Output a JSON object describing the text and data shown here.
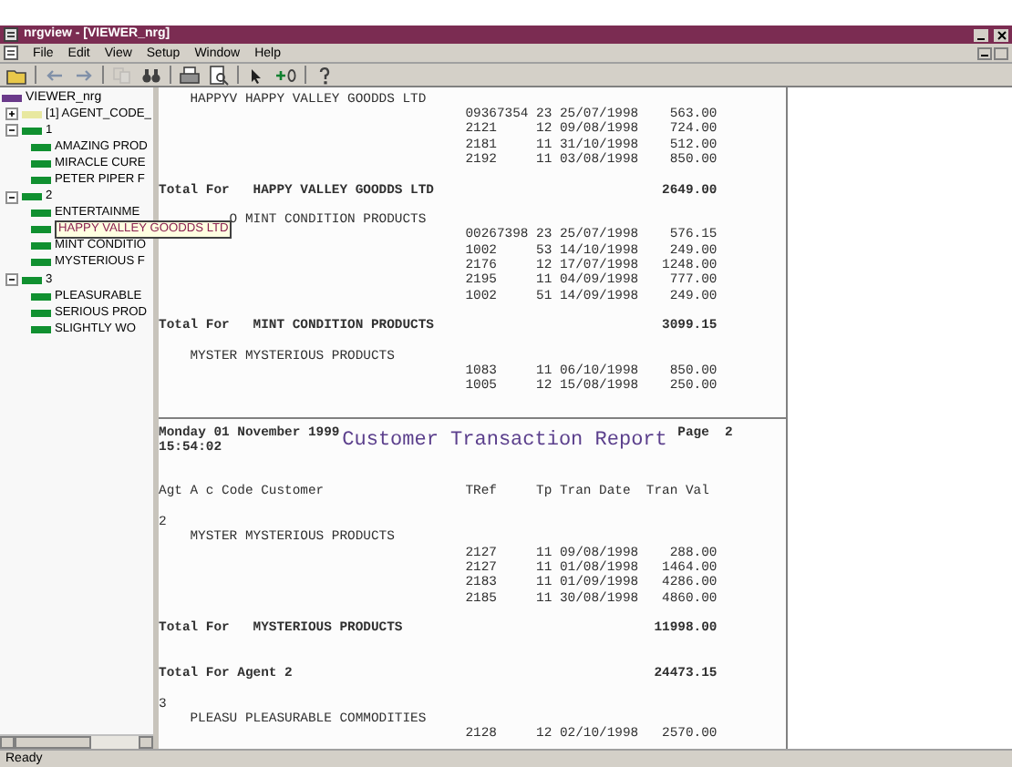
{
  "window": {
    "title": "nrgview - [VIEWER_nrg]"
  },
  "menu": [
    "File",
    "Edit",
    "View",
    "Setup",
    "Window",
    "Help"
  ],
  "toolbar": [
    {
      "kind": "open",
      "disabled": false
    },
    {
      "kind": "sep"
    },
    {
      "kind": "back",
      "disabled": false
    },
    {
      "kind": "forward",
      "disabled": false
    },
    {
      "kind": "sep"
    },
    {
      "kind": "copy",
      "disabled": true
    },
    {
      "kind": "find",
      "disabled": false
    },
    {
      "kind": "sep"
    },
    {
      "kind": "print",
      "disabled": false
    },
    {
      "kind": "preview",
      "disabled": false
    },
    {
      "kind": "sep"
    },
    {
      "kind": "pointer",
      "disabled": false
    },
    {
      "kind": "plus",
      "disabled": false
    },
    {
      "kind": "sep"
    },
    {
      "kind": "help",
      "disabled": false
    }
  ],
  "tree": {
    "root": "VIEWER_nrg",
    "items": [
      {
        "label": "[1] AGENT_CODE_",
        "kind": "code",
        "expanded": false,
        "highlighted": false
      },
      {
        "label": "1",
        "kind": "agent",
        "expanded": true,
        "highlighted": false,
        "children": [
          {
            "label": "AMAZING PROD",
            "kind": "customer",
            "highlighted": false
          },
          {
            "label": "MIRACLE CURE",
            "kind": "customer",
            "highlighted": false
          },
          {
            "label": "PETER PIPER F",
            "kind": "customer",
            "highlighted": false
          }
        ]
      },
      {
        "label": "2",
        "kind": "agent",
        "expanded": true,
        "highlighted": false,
        "children": [
          {
            "label": "ENTERTAINME",
            "kind": "customer",
            "highlighted": false
          },
          {
            "label": "HAPPY VALLEY GOODDS LTD",
            "kind": "customer",
            "highlighted": true
          },
          {
            "label": "MINT CONDITIO",
            "kind": "customer",
            "highlighted": false
          },
          {
            "label": "MYSTERIOUS F",
            "kind": "customer",
            "highlighted": false
          }
        ]
      },
      {
        "label": "3",
        "kind": "agent",
        "expanded": true,
        "highlighted": false,
        "children": [
          {
            "label": "PLEASURABLE",
            "kind": "customer",
            "highlighted": false
          },
          {
            "label": "SERIOUS PROD",
            "kind": "customer",
            "highlighted": false
          },
          {
            "label": "SLIGHTLY WO",
            "kind": "customer",
            "highlighted": false
          }
        ]
      }
    ]
  },
  "report": [
    {
      "kind": "customer",
      "code": "HAPPYV",
      "name": "HAPPY VALLEY GOODDS LTD"
    },
    {
      "kind": "transaction",
      "tref": "09367354",
      "tp": "23",
      "date": "25/07/1998",
      "value": "563.00"
    },
    {
      "kind": "transaction",
      "tref": "2121",
      "tp": "12",
      "date": "09/08/1998",
      "value": "724.00"
    },
    {
      "kind": "transaction",
      "tref": "2181",
      "tp": "11",
      "date": "31/10/1998",
      "value": "512.00"
    },
    {
      "kind": "transaction",
      "tref": "2192",
      "tp": "11",
      "date": "03/08/1998",
      "value": "850.00"
    },
    {
      "kind": "blank"
    },
    {
      "kind": "total",
      "label": "Total For",
      "name": "HAPPY VALLEY GOODDS LTD",
      "value": "2649.00"
    },
    {
      "kind": "blank"
    },
    {
      "kind": "customer",
      "code": "O",
      "name": "MINT CONDITION PRODUCTS"
    },
    {
      "kind": "transaction",
      "tref": "00267398",
      "tp": "23",
      "date": "25/07/1998",
      "value": "576.15"
    },
    {
      "kind": "transaction",
      "tref": "1002",
      "tp": "53",
      "date": "14/10/1998",
      "value": "249.00"
    },
    {
      "kind": "transaction",
      "tref": "2176",
      "tp": "12",
      "date": "17/07/1998",
      "value": "1248.00"
    },
    {
      "kind": "transaction",
      "tref": "2195",
      "tp": "11",
      "date": "04/09/1998",
      "value": "777.00"
    },
    {
      "kind": "transaction",
      "tref": "1002",
      "tp": "51",
      "date": "14/09/1998",
      "value": "249.00"
    },
    {
      "kind": "blank"
    },
    {
      "kind": "total",
      "label": "Total For",
      "name": "MINT CONDITION PRODUCTS",
      "value": "3099.15"
    },
    {
      "kind": "blank"
    },
    {
      "kind": "customer",
      "code": "MYSTER",
      "name": "MYSTERIOUS PRODUCTS"
    },
    {
      "kind": "transaction",
      "tref": "1083",
      "tp": "11",
      "date": "06/10/1998",
      "value": "850.00"
    },
    {
      "kind": "transaction",
      "tref": "1005",
      "tp": "12",
      "date": "15/08/1998",
      "value": "250.00"
    },
    {
      "kind": "blank"
    },
    {
      "kind": "page_break"
    },
    {
      "kind": "page_header",
      "date": "Monday 01 November 1999",
      "time": "15:54:02",
      "title": "Customer Transaction Report",
      "page_label": "Page",
      "page": "2"
    },
    {
      "kind": "blank"
    },
    {
      "kind": "blank"
    },
    {
      "kind": "headings",
      "columns": [
        "Agt A c Code Customer",
        "TRef",
        "Tp",
        "Tran Date",
        "Tran Val"
      ]
    },
    {
      "kind": "blank"
    },
    {
      "kind": "agent",
      "code": "2"
    },
    {
      "kind": "customer",
      "code": "MYSTER",
      "name": "MYSTERIOUS PRODUCTS"
    },
    {
      "kind": "transaction",
      "tref": "2127",
      "tp": "11",
      "date": "09/08/1998",
      "value": "288.00"
    },
    {
      "kind": "transaction",
      "tref": "2127",
      "tp": "11",
      "date": "01/08/1998",
      "value": "1464.00"
    },
    {
      "kind": "transaction",
      "tref": "2183",
      "tp": "11",
      "date": "01/09/1998",
      "value": "4286.00"
    },
    {
      "kind": "transaction",
      "tref": "2185",
      "tp": "11",
      "date": "30/08/1998",
      "value": "4860.00"
    },
    {
      "kind": "blank"
    },
    {
      "kind": "total",
      "label": "Total For",
      "name": "MYSTERIOUS PRODUCTS",
      "value": "11998.00"
    },
    {
      "kind": "blank"
    },
    {
      "kind": "blank"
    },
    {
      "kind": "grand_total",
      "label": "Total For Agent 2",
      "value": "24473.15"
    },
    {
      "kind": "blank"
    },
    {
      "kind": "agent",
      "code": "3"
    },
    {
      "kind": "customer",
      "code": "PLEASU",
      "name": "PLEASURABLE COMMODITIES"
    },
    {
      "kind": "transaction",
      "tref": "2128",
      "tp": "12",
      "date": "02/10/1998",
      "value": "2570.00"
    }
  ],
  "status_bar": "Ready"
}
